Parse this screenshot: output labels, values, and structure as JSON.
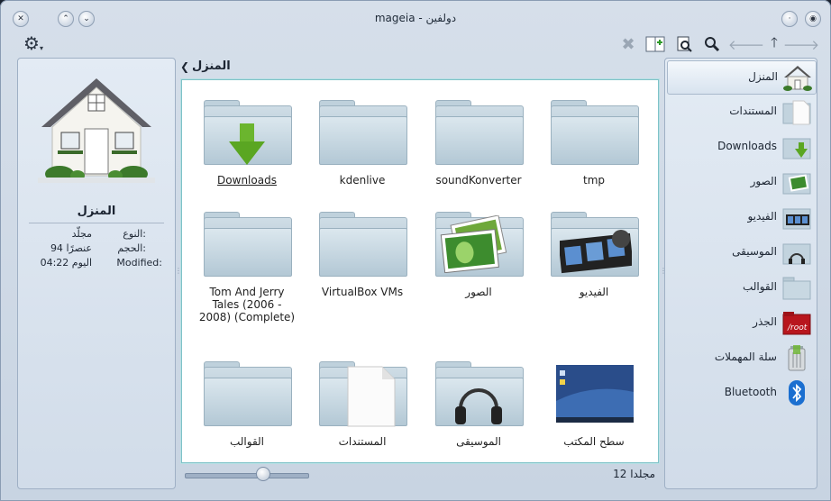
{
  "window": {
    "title": "mageia - دولفين"
  },
  "toolbar": {
    "settings_icon": "gear-icon",
    "icons": [
      "close-icon",
      "split-icon",
      "preview-icon",
      "search-icon",
      "back-icon",
      "up-icon",
      "forward-icon"
    ]
  },
  "info_panel": {
    "title": "المنزل",
    "rows": [
      {
        "key": "النوع:",
        "value": "مجلّد"
      },
      {
        "key": "الحجم:",
        "value": "94 عنصرًا"
      },
      {
        "key": "Modified:",
        "value": "اليوم 04:22"
      }
    ]
  },
  "breadcrumb": {
    "label": "المنزل"
  },
  "items": [
    {
      "label": "Downloads"
    },
    {
      "label": "kdenlive"
    },
    {
      "label": "soundKonverter"
    },
    {
      "label": "tmp"
    },
    {
      "label": "Tom And Jerry Tales (2006 - 2008) (Complete)"
    },
    {
      "label": "VirtualBox VMs"
    },
    {
      "label": "الصور"
    },
    {
      "label": "الفيديو"
    },
    {
      "label": "القوالب"
    },
    {
      "label": "المستندات"
    },
    {
      "label": "الموسيقى"
    },
    {
      "label": "سطح المكتب"
    }
  ],
  "status": {
    "text": "12 مجلدا",
    "zoom": 0.63
  },
  "places": [
    {
      "label": "المنزل",
      "selected": true
    },
    {
      "label": "المستندات"
    },
    {
      "label": "Downloads"
    },
    {
      "label": "الصور"
    },
    {
      "label": "الفيديو"
    },
    {
      "label": "الموسيقى"
    },
    {
      "label": "القوالب"
    },
    {
      "label": "الجذر"
    },
    {
      "label": "سلة المهملات"
    },
    {
      "label": "Bluetooth"
    }
  ]
}
